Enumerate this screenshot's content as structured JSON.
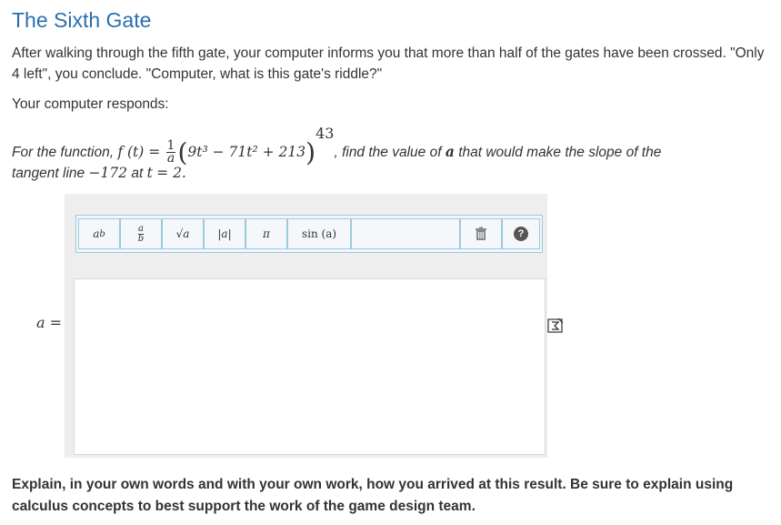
{
  "title": "The Sixth Gate",
  "intro": "After walking through the fifth gate, your computer informs you that more than half of the gates have been crossed. \"Only 4 left\", you conclude. \"Computer, what is this gate's riddle?\"",
  "responds": "Your computer responds:",
  "question": {
    "prefix": "For the function,",
    "func": "f (t) =",
    "frac_num": "1",
    "frac_den": "a",
    "poly": "9t³ − 71t² + 213",
    "exponent": "43",
    "mid": ", find the value of",
    "var_a": "a",
    "suffix": "that would make the slope of the",
    "line2_prefix": "tangent line",
    "slope_value": "−172",
    "line2_mid": "at",
    "tvar": "t",
    "eq": "= 2."
  },
  "toolbar": {
    "power_label": "a",
    "power_sup": "b",
    "fraction_num": "a",
    "fraction_den": "b",
    "sqrt_label": "√a",
    "abs_label": "|a|",
    "pi_label": "π",
    "sin_label": "sin (a)",
    "help_label": "?"
  },
  "answer_label": "a =",
  "explain": "Explain, in your own words and with your own work, how you arrived at this result. Be sure to explain using calculus concepts to best support the work of the game design team.",
  "colors": {
    "title": "#2a6fb0",
    "toolbar_border": "#9ec9de",
    "editor_bg": "#eeeeee"
  }
}
